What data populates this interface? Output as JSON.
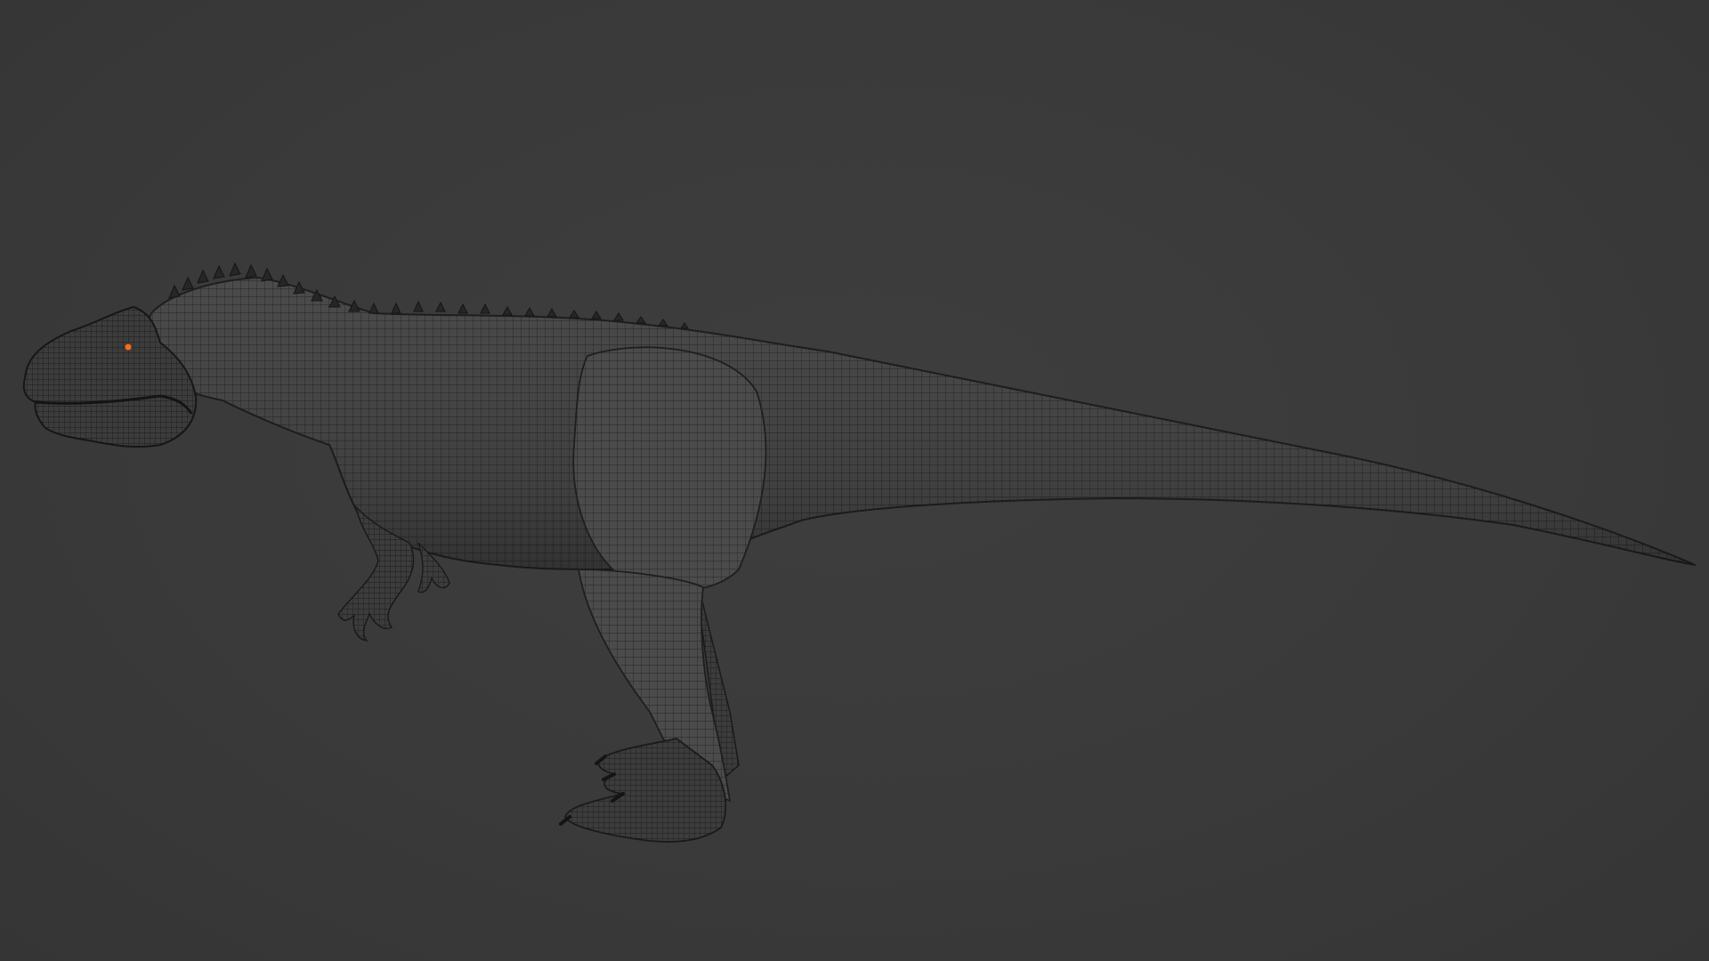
{
  "viewport": {
    "background_color": "#3a3a3a",
    "mesh_fill_color": "#4a4a4a",
    "mesh_line_color": "#1f1f1f",
    "eye_color": "#ff6a1a"
  },
  "model": {
    "icon": "dinosaur-wireframe-model"
  }
}
